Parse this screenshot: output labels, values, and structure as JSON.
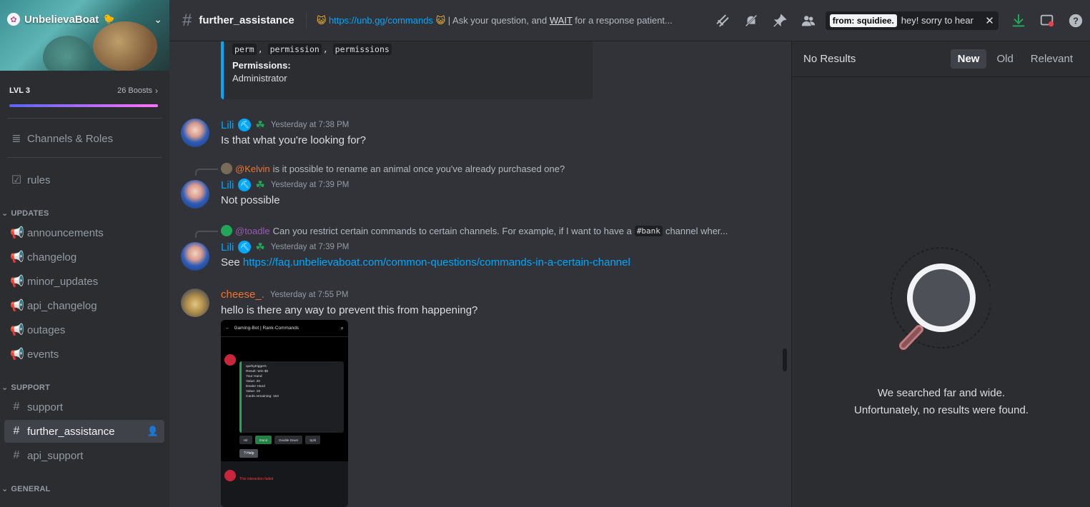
{
  "server": {
    "name": "UnbelievaBoat",
    "emoji": "🐤",
    "level": "LVL 3",
    "boosts": "26 Boosts"
  },
  "sidebar": {
    "channels_roles": "Channels & Roles",
    "rules": "rules",
    "categories": {
      "updates": "UPDATES",
      "support": "SUPPORT",
      "general": "GENERAL"
    },
    "updates_channels": [
      "announcements",
      "changelog",
      "minor_updates",
      "api_changelog",
      "outages",
      "events"
    ],
    "support_channels": [
      "support",
      "further_assistance",
      "api_support"
    ]
  },
  "topbar": {
    "channel": "further_assistance",
    "topic_link": "https://unb.gg/commands",
    "topic_pre": "| Ask your question, and ",
    "topic_wait": "WAIT",
    "topic_post": " for a response patient...",
    "search_filter": "from: squidiee.",
    "search_term": "hey! sorry to hear"
  },
  "embed": {
    "aliases": [
      "perm",
      "permission",
      "permissions"
    ],
    "field_title": "Permissions:",
    "field_value": "Administrator"
  },
  "messages": [
    {
      "author": "Lili",
      "time": "Yesterday at 7:38 PM",
      "text": "Is that what you're looking for?"
    },
    {
      "reply_to": "@Kelvin",
      "reply_text": "is it possible to rename an animal once you've already purchased one?",
      "author": "Lili",
      "time": "Yesterday at 7:39 PM",
      "text": "Not possible"
    },
    {
      "reply_to": "@toadle",
      "reply_text_a": "Can you restrict certain commands to certain channels. For example, if I want to have a",
      "reply_code": "#bank",
      "reply_text_b": "channel wher...",
      "author": "Lili",
      "time": "Yesterday at 7:39 PM",
      "text_pre": "See ",
      "link": "https://faq.unbelievaboat.com/common-questions/commands-in-a-certain-channel"
    },
    {
      "author": "cheese_.",
      "time": "Yesterday at 7:55 PM",
      "text": "hello is there any way to prevent this from happening?"
    }
  ],
  "attachment": {
    "header": "Gaming-Bot | Rank-Commands",
    "card_lines": [
      "quirkytriggers",
      "Result: Win $5",
      "Your Hand",
      "Value: 20",
      "Dealer Hand",
      "Value: 19",
      "Cards remaining: 153"
    ],
    "buttons": [
      "Hit",
      "Stand",
      "Double Down",
      "Split"
    ],
    "help": "? Help",
    "failed": "This interaction failed"
  },
  "search_panel": {
    "no_results": "No Results",
    "tabs": [
      "New",
      "Old",
      "Relevant"
    ],
    "active_tab": "New",
    "empty_line1": "We searched far and wide.",
    "empty_line2": "Unfortunately, no results were found."
  },
  "colors": {
    "link": "#00a8fc",
    "accent": "#5865f2",
    "cheese_name": "#f0742e"
  }
}
